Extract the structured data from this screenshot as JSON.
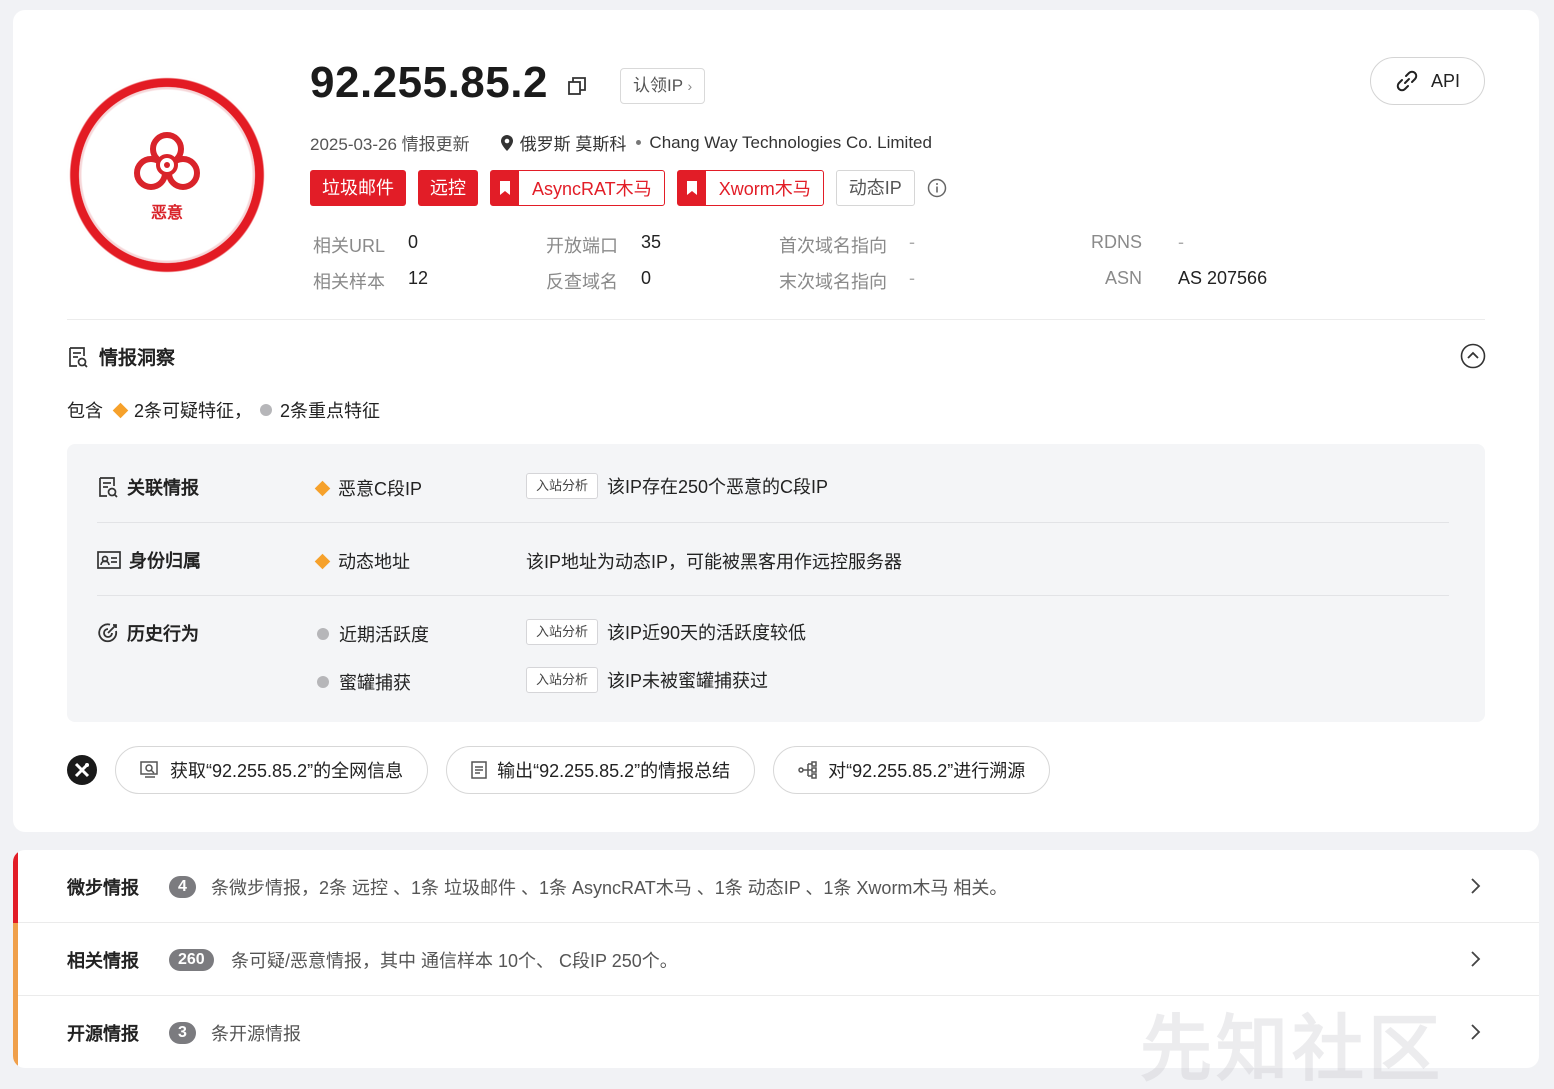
{
  "header": {
    "ip": "92.255.85.2",
    "claim_label": "认领IP",
    "api_label": "API",
    "badge_label": "恶意",
    "update_date": "2025-03-26 情报更新",
    "location": "俄罗斯 莫斯科",
    "org": "Chang Way Technologies Co. Limited"
  },
  "tags": {
    "spam": "垃圾邮件",
    "remote": "远控",
    "asyncrat": "AsyncRAT木马",
    "xworm": "Xworm木马",
    "dynamic_ip": "动态IP"
  },
  "stats": {
    "related_url_k": "相关URL",
    "related_url_v": "0",
    "open_ports_k": "开放端口",
    "open_ports_v": "35",
    "first_domain_k": "首次域名指向",
    "first_domain_v": "-",
    "rdns_k": "RDNS",
    "rdns_v": "-",
    "related_sample_k": "相关样本",
    "related_sample_v": "12",
    "reverse_domain_k": "反查域名",
    "reverse_domain_v": "0",
    "last_domain_k": "末次域名指向",
    "last_domain_v": "-",
    "asn_k": "ASN",
    "asn_v": "AS 207566"
  },
  "insight": {
    "title": "情报洞察",
    "contains": "包含",
    "suspicious": "2条可疑特征，",
    "key": "2条重点特征",
    "rows": [
      {
        "title": "关联情报",
        "feature": "恶意C段IP",
        "button": "入站分析",
        "desc": "该IP存在250个恶意的C段IP"
      },
      {
        "title": "身份归属",
        "feature": "动态地址",
        "desc": "该IP地址为动态IP，可能被黑客用作远控服务器"
      },
      {
        "title": "历史行为",
        "feature": "近期活跃度",
        "button": "入站分析",
        "desc": "该IP近90天的活跃度较低"
      },
      {
        "feature": "蜜罐捕获",
        "button": "入站分析",
        "desc": "该IP未被蜜罐捕获过"
      }
    ]
  },
  "ai": {
    "btn1": "获取“92.255.85.2”的全网信息",
    "btn2": "输出“92.255.85.2”的情报总结",
    "btn3": "对“92.255.85.2”进行溯源"
  },
  "intel": [
    {
      "title": "微步情报",
      "count": "4",
      "text": "条微步情报，2条 远控 、1条 垃圾邮件 、1条 AsyncRAT木马 、1条 动态IP 、1条 Xworm木马 相关。",
      "color": "#e21d27"
    },
    {
      "title": "相关情报",
      "count": "260",
      "text": "条可疑/恶意情报，其中 通信样本 10个、 C段IP 250个。",
      "color": "#f0a04b"
    },
    {
      "title": "开源情报",
      "count": "3",
      "text": "条开源情报",
      "color": "#f0a04b"
    }
  ],
  "watermark": "先知社区"
}
